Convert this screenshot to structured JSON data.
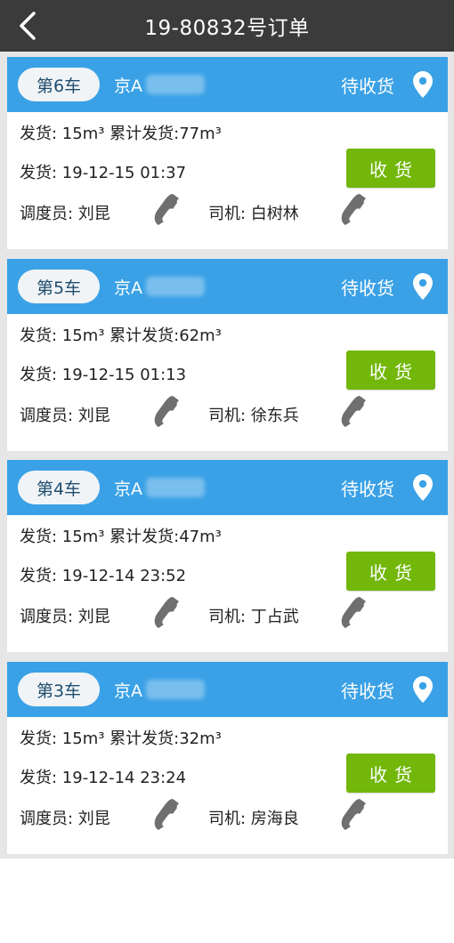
{
  "header": {
    "title": "19-80832号订单"
  },
  "colors": {
    "header_bg": "#3b3b3b",
    "card_head": "#3aa1e6",
    "action": "#72b70a"
  },
  "orders": [
    {
      "car": "第6车",
      "plate": "京A",
      "status": "待收货",
      "ship": "发货: 15m³ 累计发货:77m³",
      "time": "发货: 19-12-15 01:37",
      "dispatcher": "调度员: 刘昆",
      "driver": "司机: 白树林",
      "action": "收货"
    },
    {
      "car": "第5车",
      "plate": "京A",
      "status": "待收货",
      "ship": "发货: 15m³ 累计发货:62m³",
      "time": "发货: 19-12-15 01:13",
      "dispatcher": "调度员: 刘昆",
      "driver": "司机: 徐东兵",
      "action": "收货"
    },
    {
      "car": "第4车",
      "plate": "京A",
      "status": "待收货",
      "ship": "发货: 15m³ 累计发货:47m³",
      "time": "发货: 19-12-14 23:52",
      "dispatcher": "调度员: 刘昆",
      "driver": "司机: 丁占武",
      "action": "收货"
    },
    {
      "car": "第3车",
      "plate": "京A",
      "status": "待收货",
      "ship": "发货: 15m³ 累计发货:32m³",
      "time": "发货: 19-12-14 23:24",
      "dispatcher": "调度员: 刘昆",
      "driver": "司机: 房海良",
      "action": "收货"
    }
  ]
}
